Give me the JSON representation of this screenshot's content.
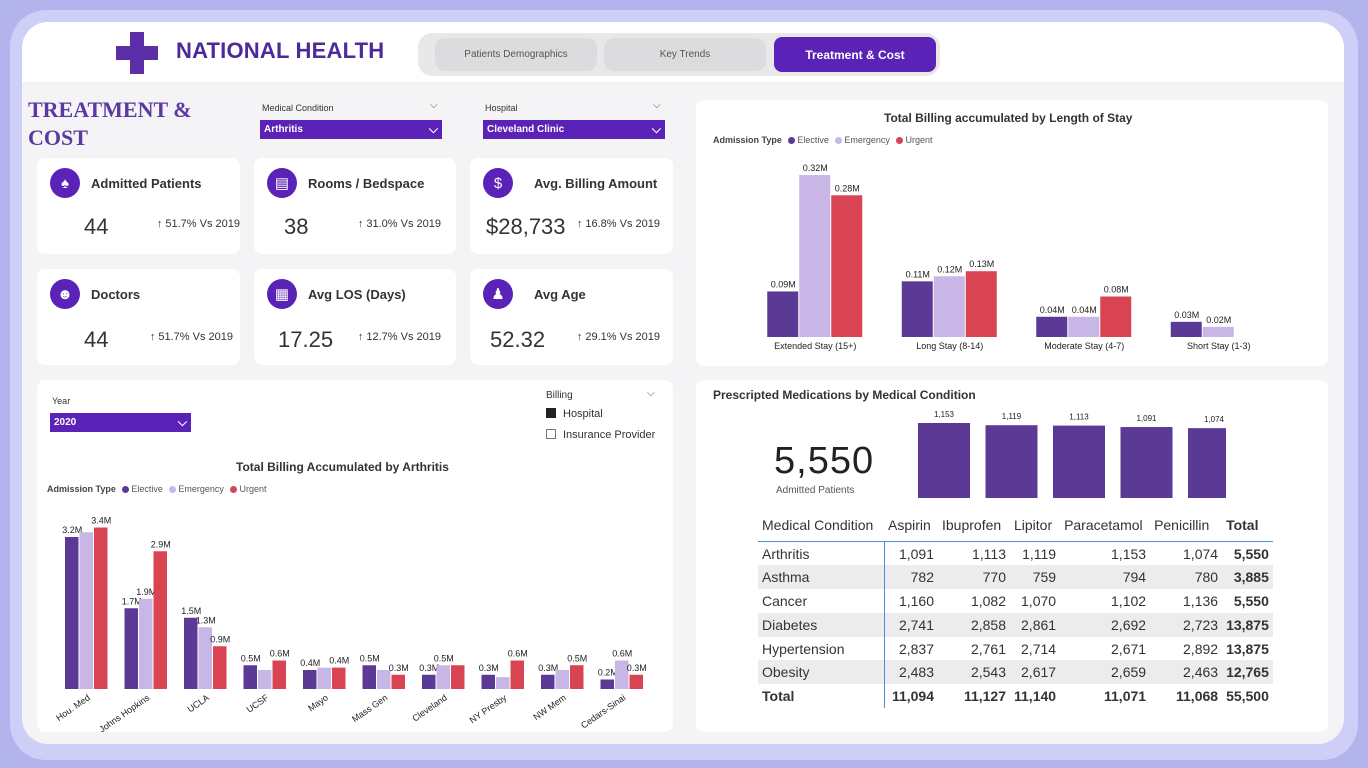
{
  "brand": {
    "name": "NATIONAL HEALTH"
  },
  "tabs": [
    {
      "label": "Patients Demographics",
      "active": false
    },
    {
      "label": "Key Trends",
      "active": false
    },
    {
      "label": "Treatment & Cost",
      "active": true
    }
  ],
  "page": {
    "title": "TREATMENT & COST"
  },
  "filters": {
    "medical_condition": {
      "label": "Medical Condition",
      "value": "Arthritis"
    },
    "hospital": {
      "label": "Hospital",
      "value": "Cleveland Clinic"
    },
    "year": {
      "label": "Year",
      "value": "2020"
    }
  },
  "kpis": [
    {
      "title": "Admitted Patients",
      "value": "44",
      "delta": "↑ 51.7% Vs 2019",
      "icon": "patient-icon"
    },
    {
      "title": "Rooms / Bedspace",
      "value": "38",
      "delta": "↑ 31.0% Vs 2019",
      "icon": "bed-icon"
    },
    {
      "title": "Avg. Billing Amount",
      "value": "$28,733",
      "delta": "↑ 16.8% Vs 2019",
      "icon": "money-bag-icon"
    },
    {
      "title": "Doctors",
      "value": "44",
      "delta": "↑ 51.7% Vs 2019",
      "icon": "doctor-icon"
    },
    {
      "title": "Avg LOS (Days)",
      "value": "17.25",
      "delta": "↑ 12.7% Vs 2019",
      "icon": "calendar-icon"
    },
    {
      "title": "Avg Age",
      "value": "52.32",
      "delta": "↑ 29.1% Vs 2019",
      "icon": "family-icon"
    }
  ],
  "billing_toggle": {
    "label": "Billing",
    "options": [
      {
        "label": "Hospital",
        "checked": true
      },
      {
        "label": "Insurance Provider",
        "checked": false
      }
    ]
  },
  "legend_common": {
    "title": "Admission Type",
    "items": [
      {
        "name": "Elective",
        "color": "#5b3a96"
      },
      {
        "name": "Emergency",
        "color": "#c7b6e6"
      },
      {
        "name": "Urgent",
        "color": "#d94452"
      }
    ]
  },
  "medications": {
    "title": "Prescripted Medications by Medical Condition",
    "big_number": "5,550",
    "big_label": "Admitted Patients",
    "table": {
      "headers": [
        "Medical Condition",
        "Aspirin",
        "Ibuprofen",
        "Lipitor",
        "Paracetamol",
        "Penicillin",
        "Total"
      ],
      "rows": [
        [
          "Arthritis",
          "1,091",
          "1,113",
          "1,119",
          "1,153",
          "1,074",
          "5,550"
        ],
        [
          "Asthma",
          "782",
          "770",
          "759",
          "794",
          "780",
          "3,885"
        ],
        [
          "Cancer",
          "1,160",
          "1,082",
          "1,070",
          "1,102",
          "1,136",
          "5,550"
        ],
        [
          "Diabetes",
          "2,741",
          "2,858",
          "2,861",
          "2,692",
          "2,723",
          "13,875"
        ],
        [
          "Hypertension",
          "2,837",
          "2,761",
          "2,714",
          "2,671",
          "2,892",
          "13,875"
        ],
        [
          "Obesity",
          "2,483",
          "2,543",
          "2,617",
          "2,659",
          "2,463",
          "12,765"
        ]
      ],
      "total": [
        "Total",
        "11,094",
        "11,127",
        "11,140",
        "11,071",
        "11,068",
        "55,500"
      ]
    }
  },
  "chart_data": [
    {
      "type": "bar",
      "title": "Total Billing accumulated by Length of Stay",
      "legend_title": "Admission Type",
      "categories": [
        "Extended Stay (15+)",
        "Long Stay (8-14)",
        "Moderate Stay (4-7)",
        "Short Stay (1-3)"
      ],
      "series": [
        {
          "name": "Elective",
          "color": "#5b3a96",
          "values": [
            0.09,
            0.11,
            0.04,
            0.03
          ],
          "labels": [
            "0.09M",
            "0.11M",
            "0.04M",
            "0.03M"
          ]
        },
        {
          "name": "Emergency",
          "color": "#c7b6e6",
          "values": [
            0.32,
            0.12,
            0.04,
            0.02
          ],
          "labels": [
            "0.32M",
            "0.12M",
            "0.04M",
            "0.02M"
          ]
        },
        {
          "name": "Urgent",
          "color": "#d94452",
          "values": [
            0.28,
            0.13,
            0.08,
            null
          ],
          "labels": [
            "0.28M",
            "0.13M",
            "0.08M",
            ""
          ]
        }
      ],
      "ylim": [
        0,
        0.33
      ]
    },
    {
      "type": "bar",
      "title": "Total Billing Accumulated by Arthritis",
      "legend_title": "Admission Type",
      "categories": [
        "Hou. Med",
        "Johns Hopkins",
        "UCLA",
        "UCSF",
        "Mayo",
        "Mass Gen",
        "Cleveland",
        "NY Presby",
        "NW Mem",
        "Cedars-Sinai"
      ],
      "series": [
        {
          "name": "Elective",
          "color": "#5b3a96",
          "values": [
            3.2,
            1.7,
            1.5,
            0.5,
            0.4,
            0.5,
            0.3,
            0.3,
            0.3,
            0.2
          ],
          "labels": [
            "3.2M",
            "1.7M",
            "1.5M",
            "0.5M",
            "0.4M",
            "0.5M",
            "0.3M",
            "0.3M",
            "0.3M",
            "0.2M"
          ]
        },
        {
          "name": "Emergency",
          "color": "#c7b6e6",
          "values": [
            3.3,
            1.9,
            1.3,
            0.4,
            0.45,
            0.4,
            0.5,
            0.25,
            0.4,
            0.6
          ],
          "labels": [
            "",
            "1.9M",
            "1.3M",
            "",
            "",
            "",
            "0.5M",
            "",
            "",
            "0.6M"
          ]
        },
        {
          "name": "Urgent",
          "color": "#d94452",
          "values": [
            3.4,
            2.9,
            0.9,
            0.6,
            0.45,
            0.3,
            0.5,
            0.6,
            0.5,
            0.3
          ],
          "labels": [
            "3.4M",
            "2.9M",
            "0.9M",
            "0.6M",
            "0.4M",
            "0.3M",
            "",
            "0.6M",
            "0.5M",
            "0.3M"
          ]
        }
      ],
      "ylim": [
        0,
        3.6
      ]
    },
    {
      "type": "bar",
      "title": "",
      "categories": [
        "Aspirin",
        "Ibuprofen",
        "Lipitor",
        "Paracetamol",
        "Penicillin"
      ],
      "series": [
        {
          "color": "#5b3a96",
          "values": [
            1153,
            1119,
            1113,
            1091,
            1074
          ],
          "labels": [
            "1,153",
            "1,119",
            "1,113",
            "1,091",
            "1,074"
          ]
        }
      ],
      "ylim": [
        0,
        1153
      ]
    }
  ]
}
